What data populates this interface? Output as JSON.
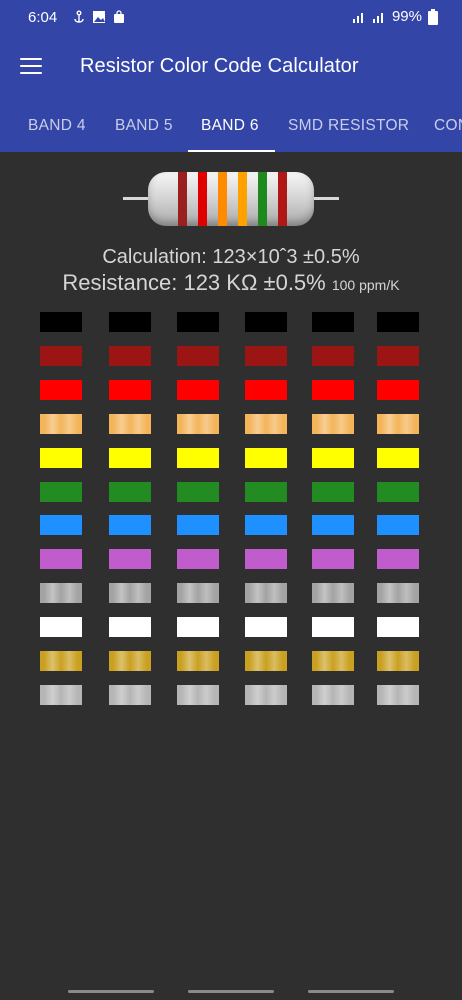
{
  "status": {
    "time": "6:04",
    "battery": "99%"
  },
  "appbar": {
    "title": "Resistor Color Code Calculator"
  },
  "tabs": [
    "BAND 4",
    "BAND 5",
    "BAND 6",
    "SMD RESISTOR",
    "CON"
  ],
  "active_tab": "BAND 6",
  "resistor": {
    "bands": [
      "#9a1f1f",
      "#e00000",
      "#ff8c00",
      "#ffa200",
      "#1e8a1e",
      "#b01818"
    ]
  },
  "result": {
    "calculation": "Calculation: 123×10ˆ3 ±0.5%",
    "resistance": "Resistance: 123 KΩ ±0.5%",
    "tempco": "100 ppm/K"
  },
  "colors": [
    {
      "name": "black",
      "hex": "#000000"
    },
    {
      "name": "brown",
      "hex": "#9c1515"
    },
    {
      "name": "red",
      "hex": "#ff0000"
    },
    {
      "name": "orange",
      "hex": "#f4b45a"
    },
    {
      "name": "yellow",
      "hex": "#ffff00"
    },
    {
      "name": "green",
      "hex": "#228b22"
    },
    {
      "name": "blue",
      "hex": "#1e90ff"
    },
    {
      "name": "violet",
      "hex": "#c05ccc"
    },
    {
      "name": "grey",
      "hex": "#a3a3a3"
    },
    {
      "name": "white",
      "hex": "#ffffff"
    },
    {
      "name": "gold",
      "hex": "#c9a020"
    },
    {
      "name": "silver",
      "hex": "#b5b5b5"
    }
  ]
}
